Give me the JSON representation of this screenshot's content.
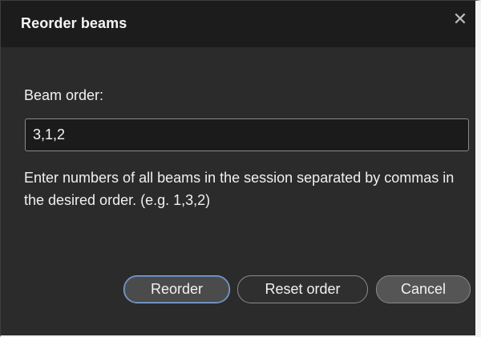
{
  "dialog": {
    "title": "Reorder beams",
    "close_symbol": "✕",
    "field_label": "Beam order:",
    "input_value": "3,1,2",
    "help_text": "Enter numbers of all beams in the session separated by commas in the desired order. (e.g. 1,3,2)",
    "buttons": {
      "reorder": "Reorder",
      "reset": "Reset order",
      "cancel": "Cancel"
    },
    "accent_color": "#88aee0"
  }
}
